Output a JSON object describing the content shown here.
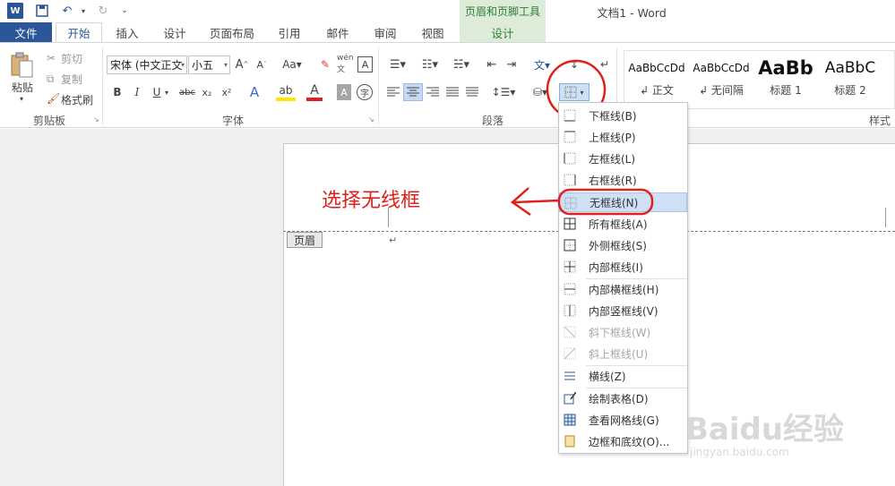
{
  "titlebar": {
    "title": "文档1 - Word",
    "context_group": "页眉和页脚工具",
    "context_tab": "设计"
  },
  "tabs": {
    "file": "文件",
    "home": "开始",
    "insert": "插入",
    "design": "设计",
    "layout": "页面布局",
    "references": "引用",
    "mailings": "邮件",
    "review": "审阅",
    "view": "视图"
  },
  "clipboard": {
    "paste": "粘贴",
    "cut": "剪切",
    "copy": "复制",
    "format_painter": "格式刷",
    "label": "剪贴板"
  },
  "font": {
    "name": "宋体 (中文正文",
    "size": "小五",
    "label": "字体"
  },
  "paragraph": {
    "label": "段落"
  },
  "styles": {
    "label": "样式",
    "items": [
      {
        "sample": "AaBbCcDd",
        "name": "↲ 正文"
      },
      {
        "sample": "AaBbCcDd",
        "name": "↲ 无间隔"
      },
      {
        "sample": "AaBb",
        "name": "标题 1"
      },
      {
        "sample": "AaBbC",
        "name": "标题 2"
      }
    ]
  },
  "document": {
    "header_tag": "页眉",
    "para_mark": "↵"
  },
  "annotation": {
    "text": "选择无线框"
  },
  "border_menu": {
    "items": [
      {
        "label": "下框线(B)",
        "enabled": true
      },
      {
        "label": "上框线(P)",
        "enabled": true
      },
      {
        "label": "左框线(L)",
        "enabled": true
      },
      {
        "label": "右框线(R)",
        "enabled": true
      },
      {
        "label": "无框线(N)",
        "enabled": true,
        "highlighted": true
      },
      {
        "label": "所有框线(A)",
        "enabled": true
      },
      {
        "label": "外侧框线(S)",
        "enabled": true
      },
      {
        "label": "内部框线(I)",
        "enabled": true
      },
      {
        "label": "内部横框线(H)",
        "enabled": true
      },
      {
        "label": "内部竖框线(V)",
        "enabled": true
      },
      {
        "label": "斜下框线(W)",
        "enabled": false
      },
      {
        "label": "斜上框线(U)",
        "enabled": false
      },
      {
        "label": "横线(Z)",
        "enabled": true
      },
      {
        "label": "绘制表格(D)",
        "enabled": true
      },
      {
        "label": "查看网格线(G)",
        "enabled": true
      },
      {
        "label": "边框和底纹(O)...",
        "enabled": true
      }
    ]
  },
  "watermark": {
    "brand": "Baidu经验",
    "url": "jingyan.baidu.com"
  },
  "colors": {
    "accent": "#2b579a",
    "context": "#ddecd9",
    "annotation": "#e0201b",
    "highlight": "#cde0f5"
  }
}
